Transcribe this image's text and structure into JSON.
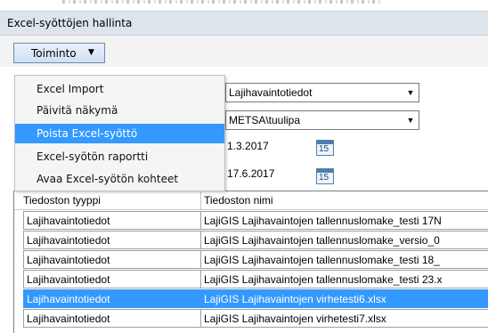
{
  "window": {
    "title": "Excel-syöttöjen hallinta"
  },
  "toolbar": {
    "actions_label": "Toiminto"
  },
  "menu": {
    "items": [
      {
        "label": "Excel Import"
      },
      {
        "label": "Päivitä näkymä"
      },
      {
        "label": "Poista Excel-syöttö",
        "selected": true
      },
      {
        "label": "Excel-syötön raportti"
      },
      {
        "label": "Avaa Excel-syötön kohteet"
      }
    ]
  },
  "filters": {
    "type_value": "Lajihavaintotiedot",
    "user_value": "METSA\\tuulipa",
    "start_date": "1.3.2017",
    "end_date": "17.6.2017",
    "calendar_day": "15"
  },
  "table": {
    "columns": [
      "Tiedoston tyyppi",
      "Tiedoston nimi"
    ],
    "rows": [
      {
        "type": "Lajihavaintotiedot",
        "name": "LajiGIS Lajihavaintojen tallennuslomake_testi 17N"
      },
      {
        "type": "Lajihavaintotiedot",
        "name": "LajiGIS Lajihavaintojen tallennuslomake_versio_0"
      },
      {
        "type": "Lajihavaintotiedot",
        "name": "LajiGIS Lajihavaintojen tallennuslomake_testi 18_"
      },
      {
        "type": "Lajihavaintotiedot",
        "name": "LajiGIS Lajihavaintojen tallennuslomake_testi 23.x"
      },
      {
        "type": "Lajihavaintotiedot",
        "name": "LajiGIS Lajihavaintojen virhetesti6.xlsx",
        "selected": true
      },
      {
        "type": "Lajihavaintotiedot",
        "name": "LajiGIS Lajihavaintojen virhetesti7.xlsx"
      }
    ]
  },
  "colors": {
    "selection": "#3399ff",
    "title_bar": "#dde4ec"
  }
}
